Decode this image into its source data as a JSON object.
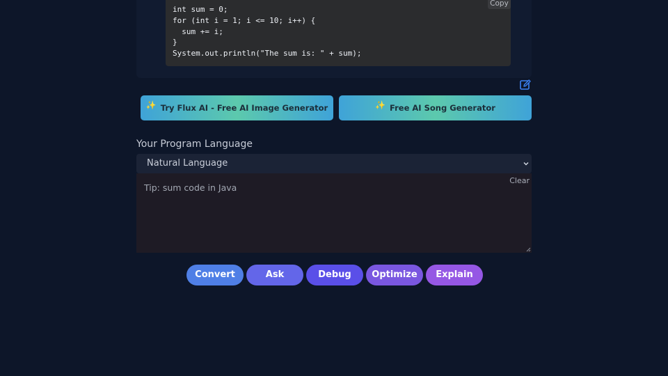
{
  "code_panel": {
    "code_lines": [
      "int sum = 0;",
      "for (int i = 1; i <= 10; i++) {",
      "  sum += i;",
      "}",
      "System.out.println(\"The sum is: \" + sum);"
    ],
    "copy_label": "Copy"
  },
  "edit_icon": "edit-icon",
  "promos": [
    {
      "label": "Try Flux AI - Free AI Image Generator",
      "icon": "sparkles-icon"
    },
    {
      "label": "Free AI Song Generator",
      "icon": "sparkles-icon"
    }
  ],
  "language": {
    "label": "Your Program Language",
    "selected": "Natural Language"
  },
  "input": {
    "placeholder": "Tip: sum code in Java",
    "value": "",
    "clear_label": "Clear"
  },
  "actions": [
    {
      "label": "Convert",
      "color": "#4f7fe6"
    },
    {
      "label": "Ask",
      "color": "#6366e9"
    },
    {
      "label": "Debug",
      "color": "#5a4fe8"
    },
    {
      "label": "Optimize",
      "color": "#7a57e0"
    },
    {
      "label": "Explain",
      "color": "#9557e4"
    }
  ],
  "colors": {
    "background": "#0d1629",
    "promo_gradient_start": "#3fa3d8",
    "promo_gradient_mid": "#5cc9ad",
    "edit_icon": "#3b82f6"
  }
}
